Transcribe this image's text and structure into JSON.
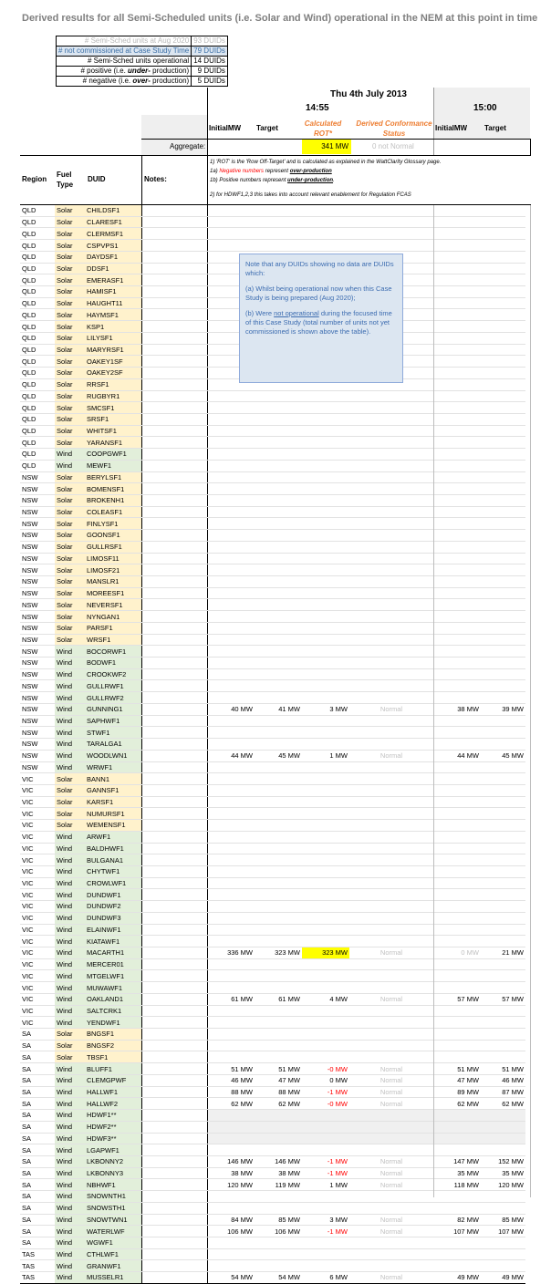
{
  "title": "Derived results for all Semi-Scheduled units (i.e. Solar and Wind) operational in the NEM at this point in time",
  "summary": [
    {
      "label": "# Semi-Sched units at Aug 2020",
      "value": "93 DUIDs"
    },
    {
      "label": "# not commissioned at Case Study Time",
      "value": "79 DUIDs"
    },
    {
      "label": "# Semi-Sched units operational",
      "value": "14 DUIDs"
    },
    {
      "label_a": "# positive (i.e. ",
      "label_b": "under-",
      "label_c": " production)",
      "value": "9 DUIDs"
    },
    {
      "label_a": "# negative (i.e. ",
      "label_b": "over-",
      "label_c": " production)",
      "value": "5 DUIDs"
    }
  ],
  "header": {
    "date": "Thu 4th July 2013",
    "time1": "14:55",
    "time2": "15:00",
    "col_initial": "InitialMW",
    "col_target": "Target",
    "col_rot": "Calculated ROT*",
    "col_status": "Derived Conformance Status",
    "col_initial2": "InitialMW",
    "col_target2": "Target",
    "aggregate_label": "Aggregate:",
    "aggregate_rot": "341 MW",
    "aggregate_status": "0 not Normal",
    "region": "Region",
    "fuel": "Fuel Type",
    "duid": "DUID",
    "notes": "Notes:"
  },
  "footnotes": {
    "n1": "1) 'ROT' is the 'Row Off-Target' and is calculated as explained in the WattClarity Glossary page.",
    "n1a_a": "1a) ",
    "n1a_b": "Negative numbers",
    "n1a_c": " represent ",
    "n1a_d": "over-production",
    "n1b_a": "1b) Positive numbers represent ",
    "n1b_b": "under-production",
    "n1b_c": ".",
    "n2": "2) for HDWF1,2,3 this takes into account relevant enablement for Regulation FCAS"
  },
  "callout": {
    "p1": "Note that any DUIDs showing no data are DUIDs which:",
    "p2": "(a)  Whilst being operational now when this Case Study is being prepared (Aug 2020);",
    "p3_a": "(b)  Were ",
    "p3_b": "not operational",
    "p3_c": " during the focused time of this Case Study (total number of units not yet commissioned is shown above the table)."
  },
  "rows": [
    [
      "QLD",
      "Solar",
      "CHILDSF1"
    ],
    [
      "QLD",
      "Solar",
      "CLARESF1"
    ],
    [
      "QLD",
      "Solar",
      "CLERMSF1"
    ],
    [
      "QLD",
      "Solar",
      "CSPVPS1"
    ],
    [
      "QLD",
      "Solar",
      "DAYDSF1"
    ],
    [
      "QLD",
      "Solar",
      "DDSF1"
    ],
    [
      "QLD",
      "Solar",
      "EMERASF1"
    ],
    [
      "QLD",
      "Solar",
      "HAMISF1"
    ],
    [
      "QLD",
      "Solar",
      "HAUGHT11"
    ],
    [
      "QLD",
      "Solar",
      "HAYMSF1"
    ],
    [
      "QLD",
      "Solar",
      "KSP1"
    ],
    [
      "QLD",
      "Solar",
      "LILYSF1"
    ],
    [
      "QLD",
      "Solar",
      "MARYRSF1"
    ],
    [
      "QLD",
      "Solar",
      "OAKEY1SF"
    ],
    [
      "QLD",
      "Solar",
      "OAKEY2SF"
    ],
    [
      "QLD",
      "Solar",
      "RRSF1"
    ],
    [
      "QLD",
      "Solar",
      "RUGBYR1"
    ],
    [
      "QLD",
      "Solar",
      "SMCSF1"
    ],
    [
      "QLD",
      "Solar",
      "SRSF1"
    ],
    [
      "QLD",
      "Solar",
      "WHITSF1"
    ],
    [
      "QLD",
      "Solar",
      "YARANSF1"
    ],
    [
      "QLD",
      "Wind",
      "COOPGWF1"
    ],
    [
      "QLD",
      "Wind",
      "MEWF1"
    ],
    [
      "NSW",
      "Solar",
      "BERYLSF1"
    ],
    [
      "NSW",
      "Solar",
      "BOMENSF1"
    ],
    [
      "NSW",
      "Solar",
      "BROKENH1"
    ],
    [
      "NSW",
      "Solar",
      "COLEASF1"
    ],
    [
      "NSW",
      "Solar",
      "FINLYSF1"
    ],
    [
      "NSW",
      "Solar",
      "GOONSF1"
    ],
    [
      "NSW",
      "Solar",
      "GULLRSF1"
    ],
    [
      "NSW",
      "Solar",
      "LIMOSF11"
    ],
    [
      "NSW",
      "Solar",
      "LIMOSF21"
    ],
    [
      "NSW",
      "Solar",
      "MANSLR1"
    ],
    [
      "NSW",
      "Solar",
      "MOREESF1"
    ],
    [
      "NSW",
      "Solar",
      "NEVERSF1"
    ],
    [
      "NSW",
      "Solar",
      "NYNGAN1"
    ],
    [
      "NSW",
      "Solar",
      "PARSF1"
    ],
    [
      "NSW",
      "Solar",
      "WRSF1"
    ],
    [
      "NSW",
      "Wind",
      "BOCORWF1"
    ],
    [
      "NSW",
      "Wind",
      "BODWF1"
    ],
    [
      "NSW",
      "Wind",
      "CROOKWF2"
    ],
    [
      "NSW",
      "Wind",
      "GULLRWF1"
    ],
    [
      "NSW",
      "Wind",
      "GULLRWF2"
    ],
    [
      "NSW",
      "Wind",
      "GUNNING1",
      "40 MW",
      "41 MW",
      "3 MW",
      "Normal",
      "38 MW",
      "39 MW"
    ],
    [
      "NSW",
      "Wind",
      "SAPHWF1"
    ],
    [
      "NSW",
      "Wind",
      "STWF1"
    ],
    [
      "NSW",
      "Wind",
      "TARALGA1"
    ],
    [
      "NSW",
      "Wind",
      "WOODLWN1",
      "44 MW",
      "45 MW",
      "1 MW",
      "Normal",
      "44 MW",
      "45 MW"
    ],
    [
      "NSW",
      "Wind",
      "WRWF1"
    ],
    [
      "VIC",
      "Solar",
      "BANN1"
    ],
    [
      "VIC",
      "Solar",
      "GANNSF1"
    ],
    [
      "VIC",
      "Solar",
      "KARSF1"
    ],
    [
      "VIC",
      "Solar",
      "NUMURSF1"
    ],
    [
      "VIC",
      "Solar",
      "WEMENSF1"
    ],
    [
      "VIC",
      "Wind",
      "ARWF1"
    ],
    [
      "VIC",
      "Wind",
      "BALDHWF1"
    ],
    [
      "VIC",
      "Wind",
      "BULGANA1"
    ],
    [
      "VIC",
      "Wind",
      "CHYTWF1"
    ],
    [
      "VIC",
      "Wind",
      "CROWLWF1"
    ],
    [
      "VIC",
      "Wind",
      "DUNDWF1"
    ],
    [
      "VIC",
      "Wind",
      "DUNDWF2"
    ],
    [
      "VIC",
      "Wind",
      "DUNDWF3"
    ],
    [
      "VIC",
      "Wind",
      "ELAINWF1"
    ],
    [
      "VIC",
      "Wind",
      "KIATAWF1"
    ],
    [
      "VIC",
      "Wind",
      "MACARTH1",
      "336 MW",
      "323 MW",
      "323 MW",
      "Normal",
      "0 MW",
      "21 MW"
    ],
    [
      "VIC",
      "Wind",
      "MERCER01"
    ],
    [
      "VIC",
      "Wind",
      "MTGELWF1"
    ],
    [
      "VIC",
      "Wind",
      "MUWAWF1"
    ],
    [
      "VIC",
      "Wind",
      "OAKLAND1",
      "61 MW",
      "61 MW",
      "4 MW",
      "Normal",
      "57 MW",
      "57 MW"
    ],
    [
      "VIC",
      "Wind",
      "SALTCRK1"
    ],
    [
      "VIC",
      "Wind",
      "YENDWF1"
    ],
    [
      "SA",
      "Solar",
      "BNGSF1"
    ],
    [
      "SA",
      "Solar",
      "BNGSF2"
    ],
    [
      "SA",
      "Solar",
      "TBSF1"
    ],
    [
      "SA",
      "Wind",
      "BLUFF1",
      "51 MW",
      "51 MW",
      "-0 MW",
      "Normal",
      "51 MW",
      "51 MW"
    ],
    [
      "SA",
      "Wind",
      "CLEMGPWF",
      "46 MW",
      "47 MW",
      "0 MW",
      "Normal",
      "47 MW",
      "46 MW"
    ],
    [
      "SA",
      "Wind",
      "HALLWF1",
      "88 MW",
      "88 MW",
      "-1 MW",
      "Normal",
      "89 MW",
      "87 MW"
    ],
    [
      "SA",
      "Wind",
      "HALLWF2",
      "62 MW",
      "62 MW",
      "-0 MW",
      "Normal",
      "62 MW",
      "62 MW"
    ],
    [
      "SA",
      "Wind",
      "HDWF1**"
    ],
    [
      "SA",
      "Wind",
      "HDWF2**"
    ],
    [
      "SA",
      "Wind",
      "HDWF3**"
    ],
    [
      "SA",
      "Wind",
      "LGAPWF1"
    ],
    [
      "SA",
      "Wind",
      "LKBONNY2",
      "146 MW",
      "146 MW",
      "-1 MW",
      "Normal",
      "147 MW",
      "152 MW"
    ],
    [
      "SA",
      "Wind",
      "LKBONNY3",
      "38 MW",
      "38 MW",
      "-1 MW",
      "Normal",
      "35 MW",
      "35 MW"
    ],
    [
      "SA",
      "Wind",
      "NBHWF1",
      "120 MW",
      "119 MW",
      "1 MW",
      "Normal",
      "118 MW",
      "120 MW"
    ],
    [
      "SA",
      "Wind",
      "SNOWNTH1"
    ],
    [
      "SA",
      "Wind",
      "SNOWSTH1"
    ],
    [
      "SA",
      "Wind",
      "SNOWTWN1",
      "84 MW",
      "85 MW",
      "3 MW",
      "Normal",
      "82 MW",
      "85 MW"
    ],
    [
      "SA",
      "Wind",
      "WATERLWF",
      "106 MW",
      "106 MW",
      "-1 MW",
      "Normal",
      "107 MW",
      "107 MW"
    ],
    [
      "SA",
      "Wind",
      "WGWF1"
    ],
    [
      "TAS",
      "Wind",
      "CTHLWF1"
    ],
    [
      "TAS",
      "Wind",
      "GRANWF1"
    ],
    [
      "TAS",
      "Wind",
      "MUSSELR1",
      "54 MW",
      "54 MW",
      "6 MW",
      "Normal",
      "49 MW",
      "49 MW"
    ]
  ]
}
